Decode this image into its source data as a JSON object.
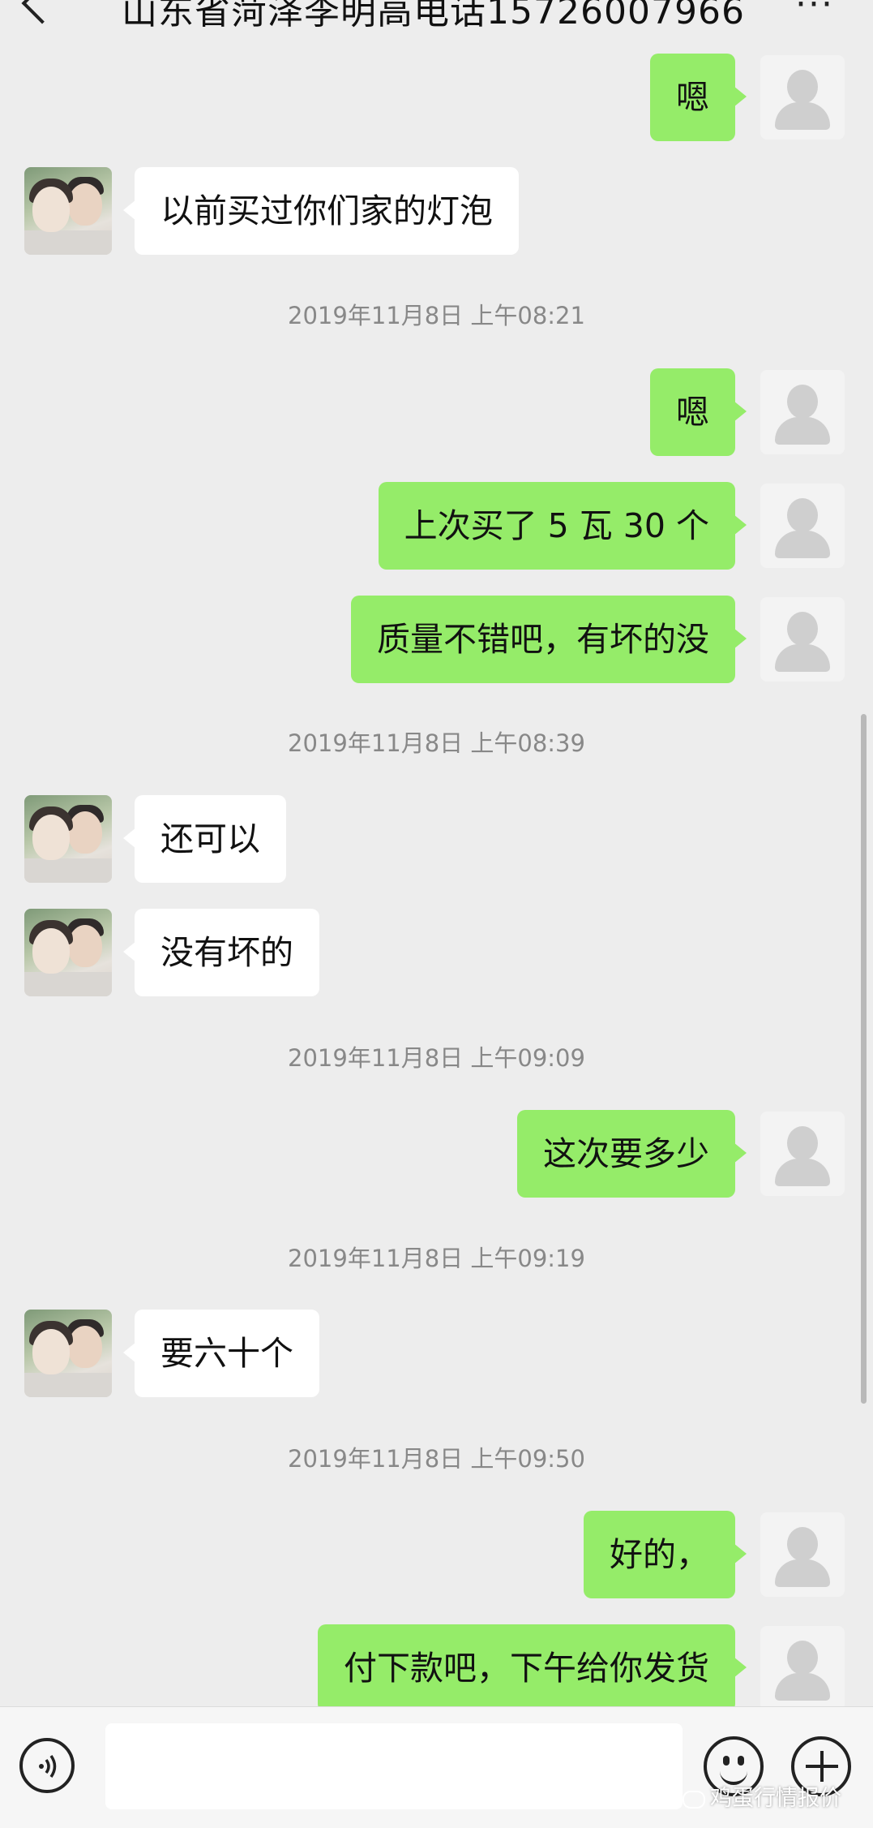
{
  "header": {
    "title": "山东省菏泽李明高电话15726007966",
    "more_label": "···"
  },
  "messages": [
    {
      "side": "self",
      "text": "嗯"
    },
    {
      "side": "other",
      "text": "以前买过你们家的灯泡"
    },
    {
      "timestamp": "2019年11月8日 上午08:21"
    },
    {
      "side": "self",
      "text": "嗯"
    },
    {
      "side": "self",
      "text": "上次买了 5 瓦 30 个"
    },
    {
      "side": "self",
      "text": "质量不错吧，有坏的没"
    },
    {
      "timestamp": "2019年11月8日 上午08:39"
    },
    {
      "side": "other",
      "text": "还可以"
    },
    {
      "side": "other",
      "text": "没有坏的"
    },
    {
      "timestamp": "2019年11月8日 上午09:09"
    },
    {
      "side": "self",
      "text": "这次要多少"
    },
    {
      "timestamp": "2019年11月8日 上午09:19"
    },
    {
      "side": "other",
      "text": "要六十个"
    },
    {
      "timestamp": "2019年11月8日 上午09:50"
    },
    {
      "side": "self",
      "text": "好的，"
    },
    {
      "side": "self",
      "text": "付下款吧，下午给你发货"
    }
  ],
  "input": {
    "value": "",
    "placeholder": ""
  },
  "icons": {
    "back": "back-arrow-icon",
    "more": "more-icon",
    "voice": "voice-icon",
    "emoji": "emoji-icon",
    "plus": "plus-icon"
  },
  "watermark": {
    "text": "鸡蛋行情报价"
  },
  "colors": {
    "background": "#ededed",
    "self_bubble": "#95ec69",
    "other_bubble": "#ffffff",
    "timestamp": "#888888"
  }
}
